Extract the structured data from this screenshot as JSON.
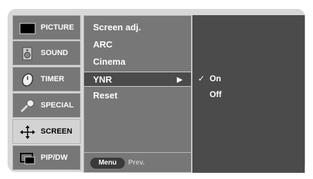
{
  "sidebar": {
    "items": [
      {
        "label": "PICTURE",
        "icon": "tv-icon"
      },
      {
        "label": "SOUND",
        "icon": "speaker-icon"
      },
      {
        "label": "TIMER",
        "icon": "clock-icon"
      },
      {
        "label": "SPECIAL",
        "icon": "key-icon"
      },
      {
        "label": "SCREEN",
        "icon": "move-arrows-icon",
        "active": true
      },
      {
        "label": "PIP/DW",
        "icon": "pip-icon"
      }
    ]
  },
  "menu": {
    "items": [
      "Screen adj.",
      "ARC",
      "Cinema",
      "YNR",
      "Reset"
    ],
    "selected": "YNR"
  },
  "footer": {
    "menu_label": "Menu",
    "prev_label": "Prev."
  },
  "options": {
    "items": [
      "On",
      "Off"
    ],
    "checked": "On"
  },
  "colors": {
    "sidebar_bg": "#777777",
    "sidebar_active_bg": "#d3d3d3",
    "panel_bg": "#777777",
    "selected_bg": "#4b4b4b",
    "options_bg": "#4b4b4b"
  }
}
